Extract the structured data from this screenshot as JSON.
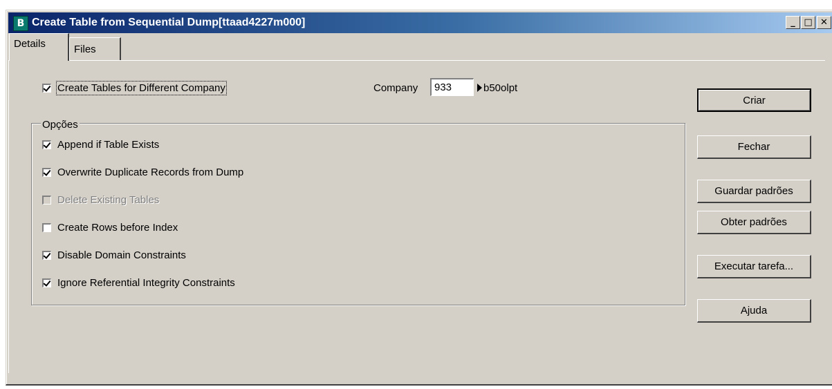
{
  "window": {
    "icon_letter": "B",
    "title": "Create Table from Sequential Dump[ttaad4227m000]",
    "controls": {
      "minimize": "_",
      "maximize": "□",
      "close": "✕"
    }
  },
  "tabs": [
    {
      "label": "Details",
      "active": true
    },
    {
      "label": "Files",
      "active": false
    }
  ],
  "details": {
    "create_tables_other_company": {
      "label": "Create Tables for Different Company",
      "checked": true
    },
    "company": {
      "label": "Company",
      "value": "933",
      "description": "b50olpt"
    },
    "options_group": {
      "legend": "Opções",
      "items": [
        {
          "label": "Append if Table Exists",
          "checked": true,
          "enabled": true
        },
        {
          "label": "Overwrite Duplicate Records from Dump",
          "checked": true,
          "enabled": true
        },
        {
          "label": "Delete Existing Tables",
          "checked": false,
          "enabled": false
        },
        {
          "label": "Create Rows before Index",
          "checked": false,
          "enabled": true
        },
        {
          "label": "Disable Domain Constraints",
          "checked": true,
          "enabled": true
        },
        {
          "label": "Ignore Referential Integrity Constraints",
          "checked": true,
          "enabled": true
        }
      ]
    }
  },
  "buttons": {
    "create": "Criar",
    "close": "Fechar",
    "save_defaults": "Guardar padrões",
    "get_defaults": "Obter padrões",
    "run_job": "Executar tarefa...",
    "help": "Ajuda"
  }
}
